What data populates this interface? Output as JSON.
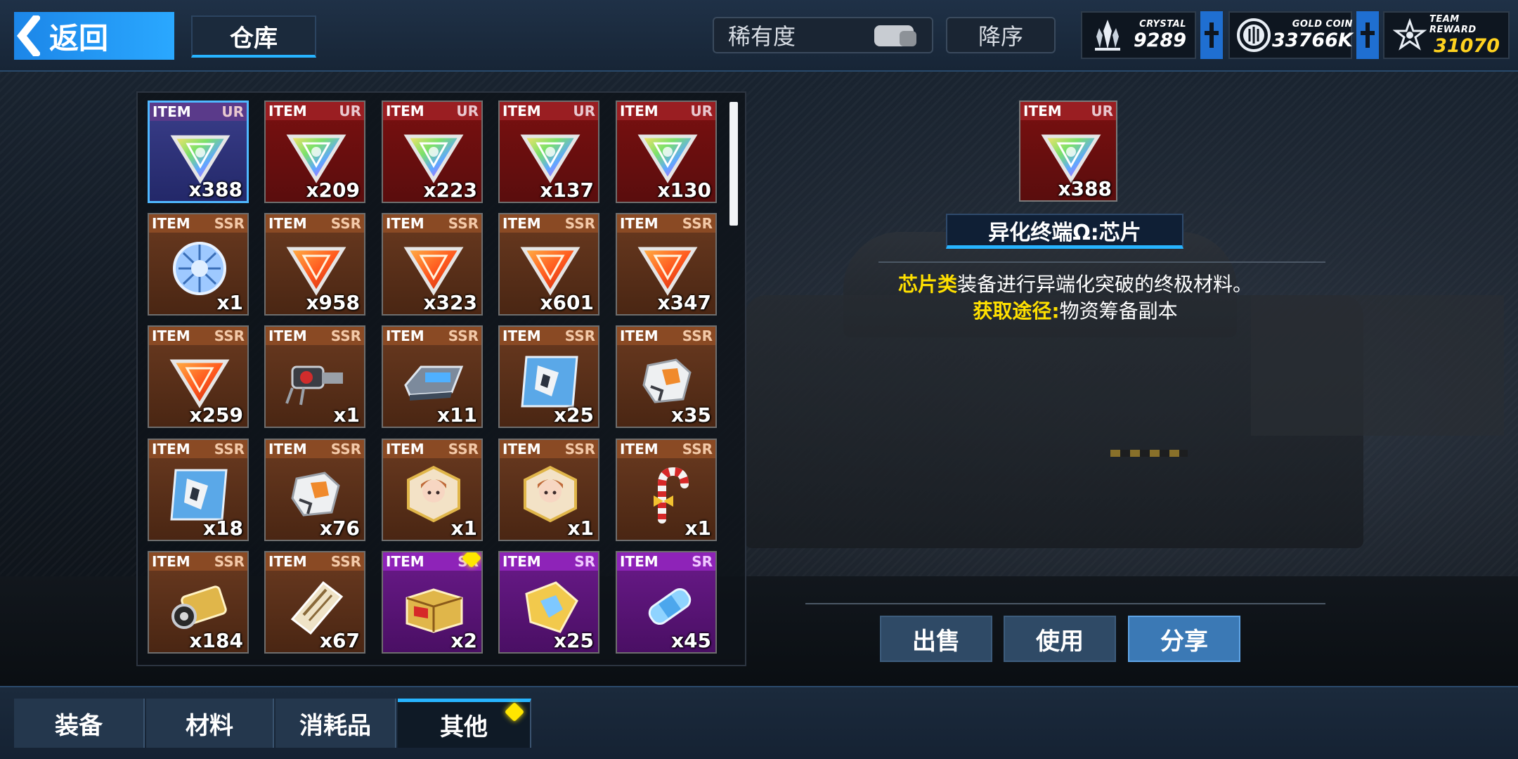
{
  "topbar": {
    "back_label": "返回",
    "title": "仓库",
    "sort_label": "稀有度",
    "order_label": "降序",
    "currencies": [
      {
        "label": "CRYSTAL",
        "value": "9289",
        "icon": "crystal-icon",
        "color": "#ffffff"
      },
      {
        "label": "GOLD COIN",
        "value": "33766K",
        "icon": "gold-coin-icon",
        "color": "#ffffff"
      },
      {
        "label": "TEAM REWARD",
        "value": "31070",
        "icon": "team-reward-icon",
        "color": "#ffd21f"
      }
    ]
  },
  "inventory": {
    "items": [
      {
        "tag": "ITEM",
        "rarity": "UR",
        "count": "x388",
        "icon": "omega-chip-icon",
        "selected": true
      },
      {
        "tag": "ITEM",
        "rarity": "UR",
        "count": "x209",
        "icon": "omega-chip-icon"
      },
      {
        "tag": "ITEM",
        "rarity": "UR",
        "count": "x223",
        "icon": "omega-chip-icon"
      },
      {
        "tag": "ITEM",
        "rarity": "UR",
        "count": "x137",
        "icon": "omega-chip-icon"
      },
      {
        "tag": "ITEM",
        "rarity": "UR",
        "count": "x130",
        "icon": "omega-chip-icon"
      },
      {
        "tag": "ITEM",
        "rarity": "SSR",
        "count": "x1",
        "icon": "tech-sphere-icon"
      },
      {
        "tag": "ITEM",
        "rarity": "SSR",
        "count": "x958",
        "icon": "orange-chip-icon"
      },
      {
        "tag": "ITEM",
        "rarity": "SSR",
        "count": "x323",
        "icon": "orange-chip-icon"
      },
      {
        "tag": "ITEM",
        "rarity": "SSR",
        "count": "x601",
        "icon": "orange-chip-icon"
      },
      {
        "tag": "ITEM",
        "rarity": "SSR",
        "count": "x347",
        "icon": "orange-chip-icon"
      },
      {
        "tag": "ITEM",
        "rarity": "SSR",
        "count": "x259",
        "icon": "orange-chip-icon"
      },
      {
        "tag": "ITEM",
        "rarity": "SSR",
        "count": "x1",
        "icon": "mech-part-icon"
      },
      {
        "tag": "ITEM",
        "rarity": "SSR",
        "count": "x11",
        "icon": "module-plate-icon"
      },
      {
        "tag": "ITEM",
        "rarity": "SSR",
        "count": "x25",
        "icon": "mech-card-icon"
      },
      {
        "tag": "ITEM",
        "rarity": "SSR",
        "count": "x35",
        "icon": "mech-armor-icon"
      },
      {
        "tag": "ITEM",
        "rarity": "SSR",
        "count": "x18",
        "icon": "mech-card-icon"
      },
      {
        "tag": "ITEM",
        "rarity": "SSR",
        "count": "x76",
        "icon": "mech-armor-icon"
      },
      {
        "tag": "ITEM",
        "rarity": "SSR",
        "count": "x1",
        "icon": "character-badge-icon"
      },
      {
        "tag": "ITEM",
        "rarity": "SSR",
        "count": "x1",
        "icon": "character-badge-icon"
      },
      {
        "tag": "ITEM",
        "rarity": "SSR",
        "count": "x1",
        "icon": "candy-cane-icon"
      },
      {
        "tag": "ITEM",
        "rarity": "SSR",
        "count": "x184",
        "icon": "energy-canister-icon"
      },
      {
        "tag": "ITEM",
        "rarity": "SSR",
        "count": "x67",
        "icon": "reference-ticket-icon"
      },
      {
        "tag": "ITEM",
        "rarity": "SR",
        "count": "x2",
        "icon": "supply-crate-icon",
        "new": true
      },
      {
        "tag": "ITEM",
        "rarity": "SR",
        "count": "x25",
        "icon": "gold-emblem-icon"
      },
      {
        "tag": "ITEM",
        "rarity": "SR",
        "count": "x45",
        "icon": "blue-capsule-icon"
      }
    ]
  },
  "detail": {
    "tag": "ITEM",
    "rarity": "UR",
    "count": "x388",
    "name": "异化终端Ω:芯片",
    "desc_highlight": "芯片类",
    "desc_text": "装备进行异端化突破的终极材料。",
    "source_label": "获取途径:",
    "source_text": "物资筹备副本"
  },
  "actions": {
    "sell": "出售",
    "use": "使用",
    "share": "分享"
  },
  "bottom_tabs": [
    "装备",
    "材料",
    "消耗品",
    "其他"
  ],
  "colors": {
    "accent": "#27b4ff",
    "highlight": "#ffe000",
    "ur": "#9a1e22",
    "ssr": "#8a4a24",
    "sr": "#8e23b8"
  }
}
